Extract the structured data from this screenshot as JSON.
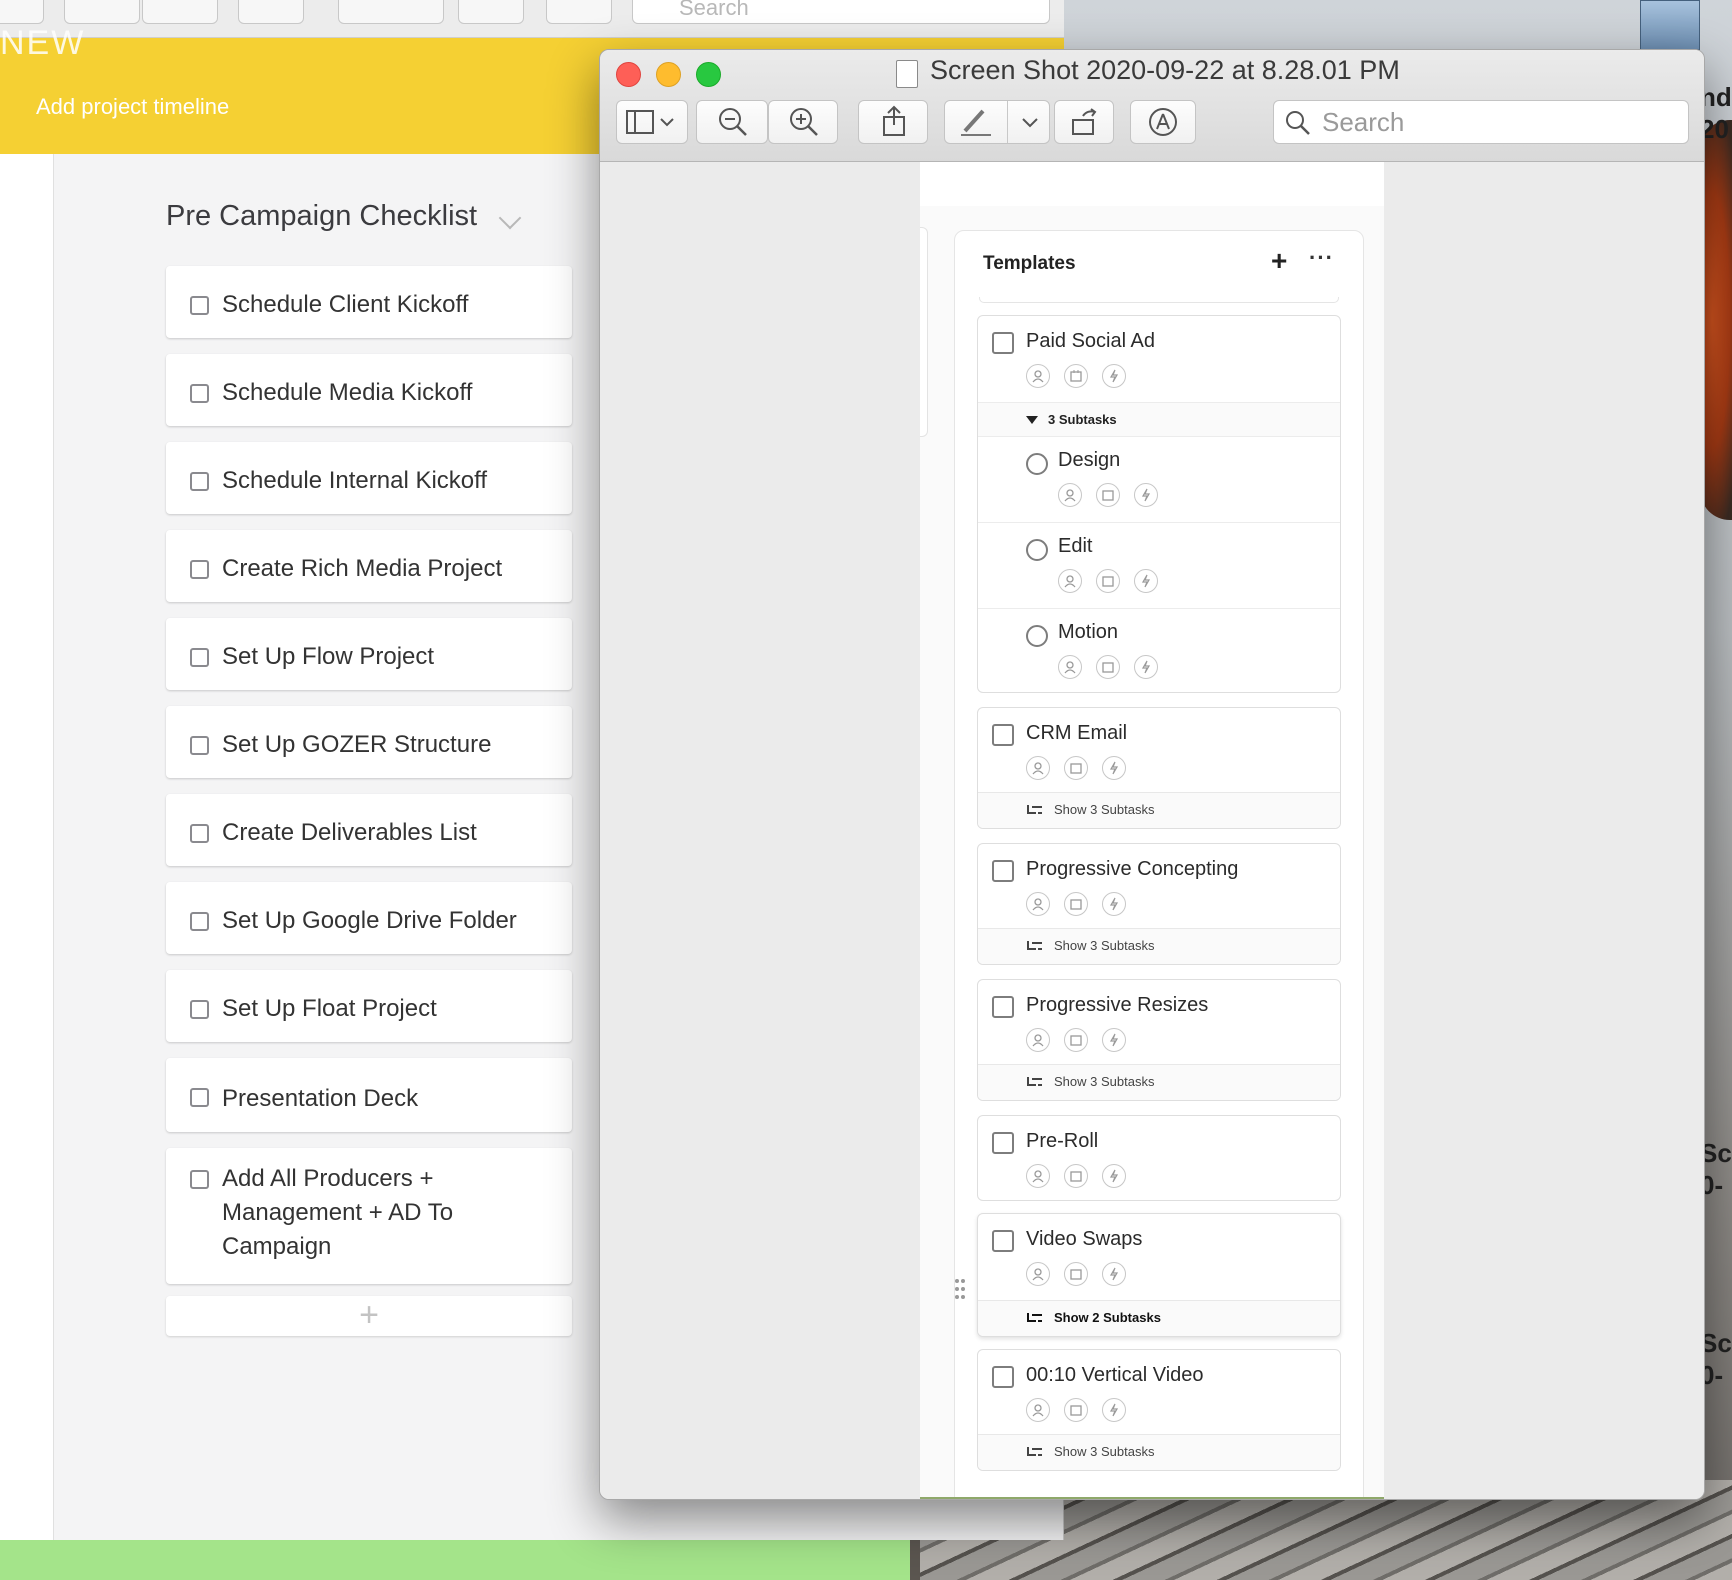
{
  "background_window": {
    "banner_title": "NEW",
    "banner_subtitle": "Add project timeline",
    "search_placeholder": "Search",
    "column_title": "Pre Campaign Checklist",
    "tasks": [
      "Schedule Client Kickoff",
      "Schedule Media Kickoff",
      "Schedule Internal Kickoff",
      "Create Rich Media Project",
      "Set Up Flow Project",
      "Set Up GOZER Structure",
      "Create Deliverables List",
      "Set Up Google Drive Folder",
      "Set Up Float Project",
      "Presentation Deck",
      "Add All Producers + Management + AD To Campaign"
    ],
    "add_symbol": "+"
  },
  "desktop": {
    "label_top_1": "nd",
    "label_top_2": "20",
    "label_mid_1": "Sc",
    "label_mid_2": "0-",
    "label_low_1": "Sc",
    "label_low_2": "0-"
  },
  "preview_window": {
    "title": "Screen Shot 2020-09-22 at 8.28.01 PM",
    "search_placeholder": "Search",
    "panel": {
      "title": "Templates",
      "add": "+",
      "more": "···",
      "templates": [
        {
          "name": "Paid Social Ad",
          "subtasks_label": "3 Subtasks",
          "subtasks": [
            "Design",
            "Edit",
            "Motion"
          ]
        },
        {
          "name": "CRM Email",
          "footer": "Show 3 Subtasks"
        },
        {
          "name": "Progressive Concepting",
          "footer": "Show 3 Subtasks"
        },
        {
          "name": "Progressive Resizes",
          "footer": "Show 3 Subtasks"
        },
        {
          "name": "Pre-Roll"
        },
        {
          "name": "Video Swaps",
          "footer": "Show 2 Subtasks"
        },
        {
          "name": "00:10 Vertical Video",
          "footer": "Show 3 Subtasks"
        }
      ]
    }
  },
  "colors": {
    "banner": "#f5d033",
    "close": "#fe5f57",
    "minimize": "#febc2e",
    "zoom": "#28c840",
    "bottom_bar": "#a4e48a"
  }
}
